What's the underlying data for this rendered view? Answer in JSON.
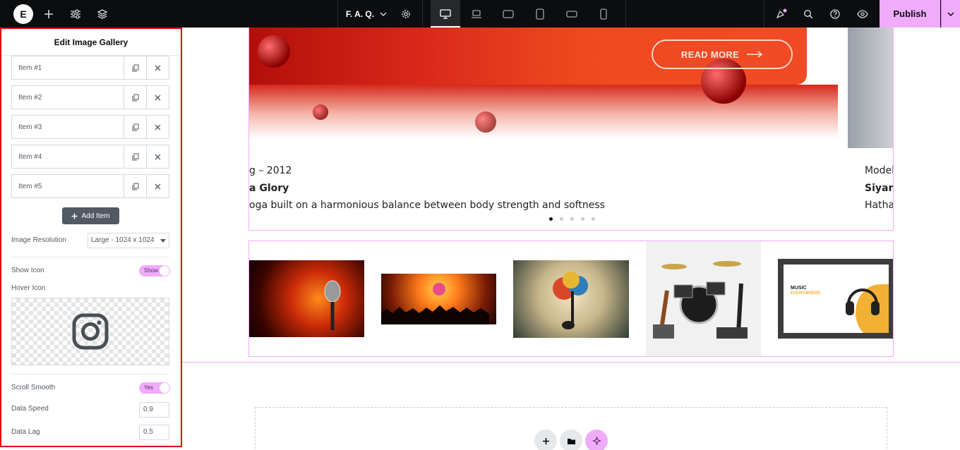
{
  "topbar": {
    "logo": "E",
    "page_name": "F. A. Q.",
    "publish_label": "Publish",
    "icons": [
      "add-icon",
      "settings-sliders-icon",
      "layers-icon",
      "chevron-down-icon",
      "gear-icon",
      "desktop-icon",
      "laptop-icon",
      "tablet-landscape-icon",
      "tablet-portrait-icon",
      "mobile-landscape-icon",
      "mobile-portrait-icon",
      "notifications-icon",
      "search-icon",
      "help-icon",
      "preview-eye-icon"
    ]
  },
  "panel": {
    "title": "Edit Image Gallery",
    "items": [
      {
        "label": "Item #1"
      },
      {
        "label": "Item #2"
      },
      {
        "label": "Item #3"
      },
      {
        "label": "Item #4"
      },
      {
        "label": "Item #5"
      }
    ],
    "add_item_label": "Add Item",
    "image_resolution": {
      "label": "Image Resolution",
      "value": "Large - 1024 x 1024"
    },
    "show_icon": {
      "label": "Show Icon",
      "value": "Show"
    },
    "hover_icon": {
      "label": "Hover Icon",
      "icon": "instagram-icon"
    },
    "scroll_smooth": {
      "label": "Scroll Smooth",
      "value": "Yes"
    },
    "data_speed": {
      "label": "Data Speed",
      "value": "0.9"
    },
    "data_lag": {
      "label": "Data Lag",
      "value": "0.5"
    }
  },
  "canvas": {
    "slide": {
      "read_more": "READ MORE",
      "date": "g – 2012",
      "title": "a Glory",
      "description": "oga built on a harmonious balance between body strength and softness",
      "next_meta": "Model",
      "next_title": "Siyan",
      "next_desc": "Hatha",
      "dots": 5,
      "active_dot": 0
    },
    "gallery_images": [
      "microphone-stage-image",
      "concert-crowd-image",
      "colorful-music-note-image",
      "drum-kit-instruments-image",
      "headphones-banner-image"
    ],
    "headphones_banner": {
      "line1": "MUSIC",
      "line2": "EVERYWHERE"
    }
  },
  "colors": {
    "accent": "#f0abfc",
    "panel_outline": "#e00000",
    "topbar_bg": "#0c0d0e"
  }
}
